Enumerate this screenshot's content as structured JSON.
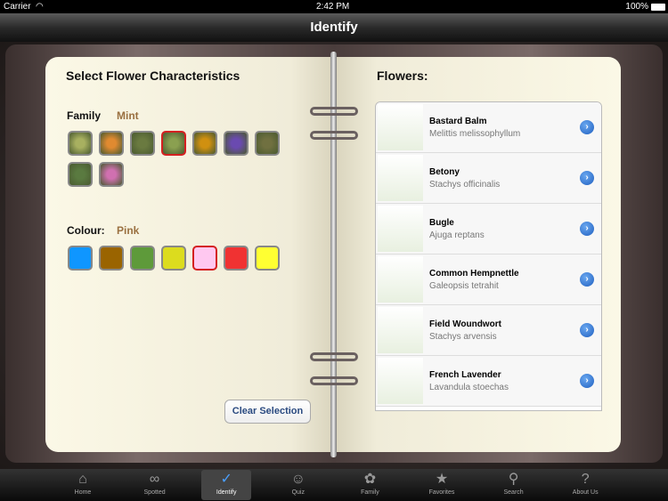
{
  "status": {
    "carrier": "Carrier",
    "time": "2:42 PM",
    "battery": "100%"
  },
  "nav": {
    "title": "Identify"
  },
  "left": {
    "title": "Select Flower Characteristics",
    "family_label": "Family",
    "family_value": "Mint",
    "colour_label": "Colour:",
    "colour_value": "Pink",
    "family_thumbs": [
      {
        "color": "#a8b060"
      },
      {
        "color": "#e08a30"
      },
      {
        "color": "#6a7a40"
      },
      {
        "color": "#8aa050",
        "selected": true
      },
      {
        "color": "#d09010"
      },
      {
        "color": "#6a4ab0"
      },
      {
        "color": "#707040"
      },
      {
        "color": "#5a7a40"
      },
      {
        "color": "#d070b0"
      }
    ],
    "colours": [
      {
        "color": "#0f96ff"
      },
      {
        "color": "#9a6400"
      },
      {
        "color": "#5e9a3a"
      },
      {
        "color": "#dcdc1e"
      },
      {
        "color": "#ffc8f0",
        "selected": true
      },
      {
        "color": "#f03232"
      },
      {
        "color": "#ffff32"
      }
    ],
    "clear_label": "Clear Selection"
  },
  "right": {
    "title": "Flowers:",
    "flowers": [
      {
        "name": "Bastard Balm",
        "latin": "Melittis melissophyllum"
      },
      {
        "name": "Betony",
        "latin": "Stachys officinalis"
      },
      {
        "name": "Bugle",
        "latin": "Ajuga reptans"
      },
      {
        "name": "Common Hempnettle",
        "latin": "Galeopsis tetrahit"
      },
      {
        "name": "Field Woundwort",
        "latin": "Stachys arvensis"
      },
      {
        "name": "French Lavender",
        "latin": "Lavandula stoechas"
      }
    ]
  },
  "tabs": [
    {
      "label": "Home",
      "icon": "home-icon"
    },
    {
      "label": "Spotted",
      "icon": "binoculars-icon"
    },
    {
      "label": "Identify",
      "icon": "check-icon",
      "active": true
    },
    {
      "label": "Quiz",
      "icon": "head-icon"
    },
    {
      "label": "Family",
      "icon": "flower-icon"
    },
    {
      "label": "Favorites",
      "icon": "star-icon"
    },
    {
      "label": "Search",
      "icon": "search-icon"
    },
    {
      "label": "About Us",
      "icon": "question-icon"
    }
  ]
}
